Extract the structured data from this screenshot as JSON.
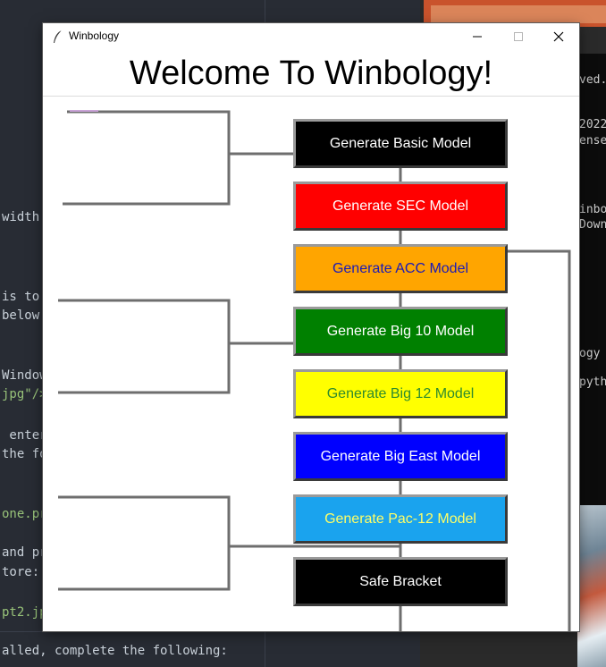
{
  "window": {
    "title": "Winbology",
    "heading": "Welcome To Winbology!"
  },
  "buttons": [
    {
      "label": "Generate Basic Model",
      "bg": "#000000",
      "fg": "#ffffff"
    },
    {
      "label": "Generate SEC Model",
      "bg": "#ff0000",
      "fg": "#ffffff"
    },
    {
      "label": "Generate ACC Model",
      "bg": "#ffa500",
      "fg": "#1a1ab8"
    },
    {
      "label": "Generate Big 10 Model",
      "bg": "#008000",
      "fg": "#ffffff"
    },
    {
      "label": "Generate Big 12 Model",
      "bg": "#ffff00",
      "fg": "#2e8b2e"
    },
    {
      "label": "Generate Big East Model",
      "bg": "#0000ff",
      "fg": "#ffffff"
    },
    {
      "label": "Generate Pac-12 Model",
      "bg": "#1aa3ee",
      "fg": "#ffff66"
    },
    {
      "label": "Safe Bracket",
      "bg": "#000000",
      "fg": "#ffffff"
    }
  ],
  "editor": {
    "lines": [
      "width:",
      "is to",
      "below:",
      "Window",
      "jpg\"/>",
      " enter",
      "the fo",
      "one.pr",
      "and pr",
      "tore:",
      "pt2.jp",
      "alled, complete the following:"
    ]
  },
  "terminal": {
    "lines": [
      "ved.",
      "2022",
      "ense'",
      "inbo",
      "Downl",
      "ogy",
      "pyth"
    ]
  }
}
